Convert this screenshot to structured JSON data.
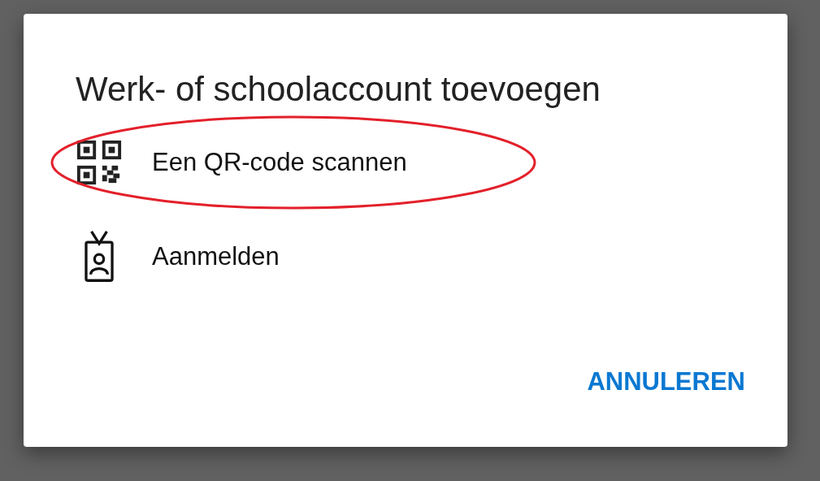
{
  "dialog": {
    "title": "Werk- of schoolaccount toevoegen",
    "options": [
      {
        "kind": "qr",
        "label": "Een QR-code scannen",
        "circled": true
      },
      {
        "kind": "badge",
        "label": "Aanmelden",
        "circled": false
      }
    ],
    "buttons": [
      "ANNULEREN"
    ]
  }
}
